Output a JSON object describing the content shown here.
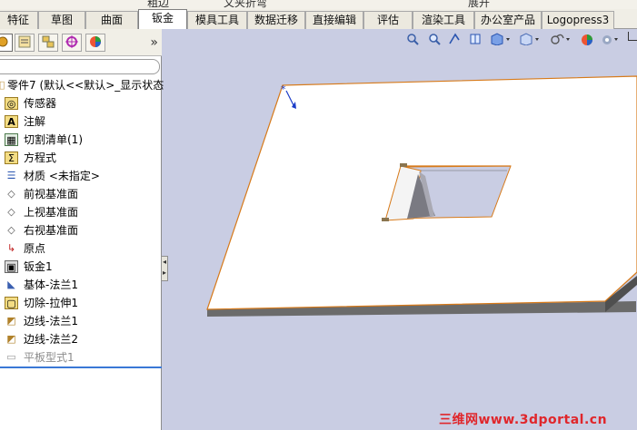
{
  "top_strip": [
    "粗边",
    "文夹折弯",
    "展开"
  ],
  "tabs": [
    "特征",
    "草图",
    "曲面",
    "钣金",
    "模具工具",
    "数据迁移",
    "直接编辑",
    "评估",
    "渲染工具",
    "办公室产品",
    "Logopress3"
  ],
  "active_tab": "钣金",
  "panel_tools": [
    "feature-manager-icon",
    "property-manager-icon",
    "configuration-manager-icon",
    "dimxpert-icon",
    "display-manager-icon"
  ],
  "panel_expand": "»",
  "tree": [
    {
      "label": "零件7  (默认<<默认>_显示状态",
      "icon": "part-icon"
    },
    {
      "label": "传感器",
      "icon": "sensor-icon"
    },
    {
      "label": "注解",
      "icon": "annotation-icon"
    },
    {
      "label": "切割清单(1)",
      "icon": "cut-list-icon"
    },
    {
      "label": "方程式",
      "icon": "equation-icon"
    },
    {
      "label": "材质 <未指定>",
      "icon": "material-icon"
    },
    {
      "label": "前视基准面",
      "icon": "plane-icon"
    },
    {
      "label": "上视基准面",
      "icon": "plane-icon"
    },
    {
      "label": "右视基准面",
      "icon": "plane-icon"
    },
    {
      "label": "原点",
      "icon": "origin-icon"
    },
    {
      "label": "钣金1",
      "icon": "sheetmetal-icon"
    },
    {
      "label": "基体-法兰1",
      "icon": "base-flange-icon"
    },
    {
      "label": "切除-拉伸1",
      "icon": "cut-extrude-icon"
    },
    {
      "label": "边线-法兰1",
      "icon": "edge-flange-icon"
    },
    {
      "label": "边线-法兰2",
      "icon": "edge-flange-icon"
    },
    {
      "label": "平板型式1",
      "icon": "flat-pattern-icon"
    }
  ],
  "view_tools": [
    "zoom-to-fit-icon",
    "zoom-area-icon",
    "previous-view-icon",
    "section-view-icon",
    "view-orientation-icon",
    "display-style-icon",
    "hide-show-icon",
    "appearance-icon",
    "scene-icon"
  ],
  "watermark": "三维网www.3dportal.cn",
  "colors": {
    "viewport": "#c9cde3",
    "edge": "#d77a1a",
    "part_face": "#ffffff",
    "watermark": "#e0262b"
  }
}
